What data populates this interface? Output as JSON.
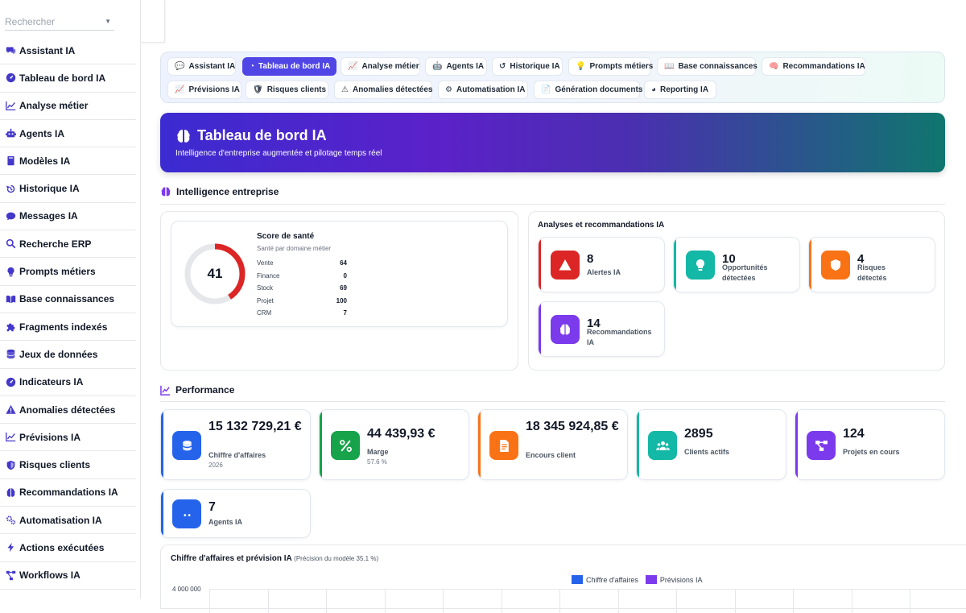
{
  "sidebar": {
    "search_placeholder": "Rechercher",
    "items": [
      {
        "label": "Assistant IA",
        "icon": "chat-icon"
      },
      {
        "label": "Tableau de bord IA",
        "icon": "gauge-icon"
      },
      {
        "label": "Analyse métier",
        "icon": "chart-line-icon"
      },
      {
        "label": "Agents IA",
        "icon": "robot-icon"
      },
      {
        "label": "Modèles IA",
        "icon": "book-icon"
      },
      {
        "label": "Historique IA",
        "icon": "history-icon"
      },
      {
        "label": "Messages IA",
        "icon": "message-icon"
      },
      {
        "label": "Recherche ERP",
        "icon": "search-icon"
      },
      {
        "label": "Prompts métiers",
        "icon": "lightbulb-icon"
      },
      {
        "label": "Base connaissances",
        "icon": "open-book-icon"
      },
      {
        "label": "Fragments indexés",
        "icon": "puzzle-icon"
      },
      {
        "label": "Jeux de données",
        "icon": "database-icon"
      },
      {
        "label": "Indicateurs IA",
        "icon": "gauge-icon"
      },
      {
        "label": "Anomalies détectées",
        "icon": "warning-icon"
      },
      {
        "label": "Prévisions IA",
        "icon": "chart-line-icon"
      },
      {
        "label": "Risques clients",
        "icon": "shield-icon"
      },
      {
        "label": "Recommandations IA",
        "icon": "brain-icon"
      },
      {
        "label": "Automatisation IA",
        "icon": "gears-icon"
      },
      {
        "label": "Actions exécutées",
        "icon": "bolt-icon"
      },
      {
        "label": "Workflows IA",
        "icon": "workflow-icon"
      }
    ]
  },
  "tabs": [
    {
      "label": "Assistant IA",
      "glyph": "💬",
      "active": false
    },
    {
      "label": "Tableau de bord IA",
      "glyph": "◔",
      "active": true
    },
    {
      "label": "Analyse métier",
      "glyph": "📈",
      "active": false
    },
    {
      "label": "Agents IA",
      "glyph": "🤖",
      "active": false
    },
    {
      "label": "Historique IA",
      "glyph": "↺",
      "active": false
    },
    {
      "label": "Prompts métiers",
      "glyph": "💡",
      "active": false
    },
    {
      "label": "Base connaissances",
      "glyph": "📖",
      "active": false
    },
    {
      "label": "Recommandations IA",
      "glyph": "🧠",
      "active": false
    },
    {
      "label": "Prévisions IA",
      "glyph": "📈",
      "active": false
    },
    {
      "label": "Risques clients",
      "glyph": "🛡",
      "active": false
    },
    {
      "label": "Anomalies détectées",
      "glyph": "⚠",
      "active": false
    },
    {
      "label": "Automatisation IA",
      "glyph": "⚙",
      "active": false
    },
    {
      "label": "Génération documents",
      "glyph": "📄",
      "active": false
    },
    {
      "label": "Reporting IA",
      "glyph": "◕",
      "active": false
    }
  ],
  "hero": {
    "title": "Tableau de bord IA",
    "subtitle": "Intelligence d'entreprise augmentée et pilotage temps réel"
  },
  "intelligence": {
    "title": "Intelligence entreprise",
    "health": {
      "score": "41",
      "score_value": 41,
      "title": "Score de santé",
      "subtitle": "Santé par domaine métier",
      "rows": [
        {
          "label": "Vente",
          "value": "64"
        },
        {
          "label": "Finance",
          "value": "0"
        },
        {
          "label": "Stock",
          "value": "69"
        },
        {
          "label": "Projet",
          "value": "100"
        },
        {
          "label": "CRM",
          "value": "7"
        }
      ]
    },
    "analyses": {
      "title": "Analyses et recommandations IA",
      "cards": [
        {
          "value": "8",
          "label": "Alertes IA",
          "color": "#dc2626",
          "icon": "warning-icon"
        },
        {
          "value": "10",
          "label": "Opportunités détectées",
          "color": "#14b8a6",
          "icon": "lightbulb-icon"
        },
        {
          "value": "4",
          "label": "Risques détectés",
          "color": "#f97316",
          "icon": "shield-icon"
        },
        {
          "value": "14",
          "label": "Recommandations IA",
          "color": "#7c3aed",
          "icon": "brain-icon"
        }
      ]
    }
  },
  "performance": {
    "title": "Performance",
    "kpis": [
      {
        "value": "15 132 729,21 €",
        "label": "Chiffre d'affaires",
        "sub": "2026",
        "color": "#2563eb",
        "icon": "coins-icon"
      },
      {
        "value": "44 439,93 €",
        "label": "Marge",
        "sub": "57.6 %",
        "color": "#16a34a",
        "icon": "percent-icon"
      },
      {
        "value": "18 345 924,85 €",
        "label": "Encours client",
        "sub": "",
        "color": "#f97316",
        "icon": "invoice-icon"
      },
      {
        "value": "2895",
        "label": "Clients actifs",
        "sub": "",
        "color": "#14b8a6",
        "icon": "users-icon"
      },
      {
        "value": "124",
        "label": "Projets en cours",
        "sub": "",
        "color": "#7c3aed",
        "icon": "diagram-icon"
      },
      {
        "value": "7",
        "label": "Agents IA",
        "sub": "",
        "color": "#2563eb",
        "icon": "robot-icon"
      }
    ]
  },
  "chart": {
    "title": "Chiffre d'affaires et prévision IA",
    "precision": "(Précision du modèle 35.1 %)"
  },
  "chart_data": {
    "type": "bar",
    "title": "Chiffre d'affaires et prévision IA",
    "series": [
      {
        "name": "Chiffre d'affaires",
        "color": "#2563eb"
      },
      {
        "name": "Prévisions IA",
        "color": "#7c3aed"
      }
    ],
    "y_ticks": [
      "4 000 000"
    ],
    "legend_position": "top-center",
    "grid": true
  }
}
